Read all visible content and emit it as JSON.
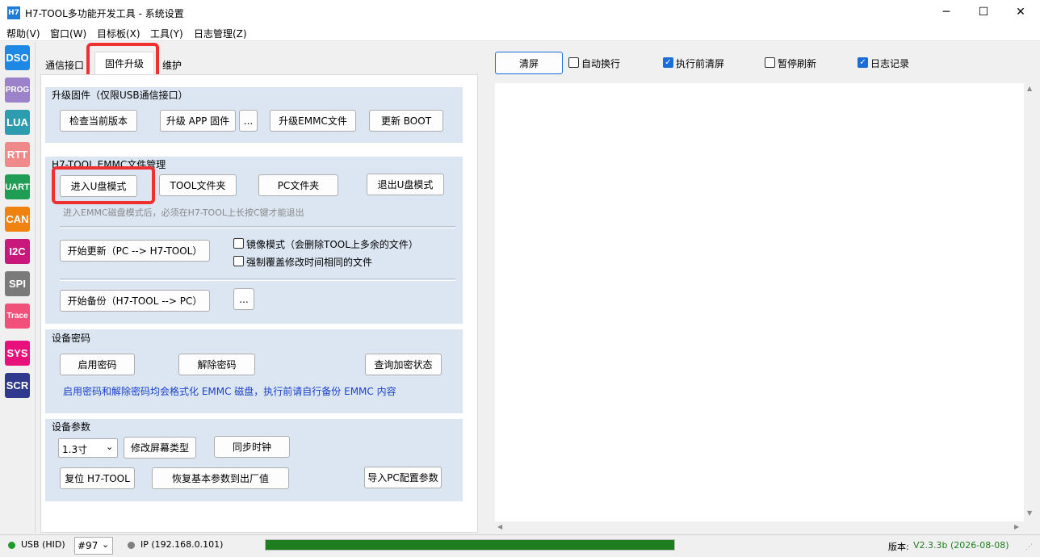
{
  "window": {
    "icon_label": "H7",
    "title": "H7-TOOL多功能开发工具 - 系统设置",
    "minimize_glyph": "─",
    "maximize_glyph": "☐",
    "close_glyph": "✕"
  },
  "menu": [
    "帮助(V)",
    "窗口(W)",
    "目标板(X)",
    "工具(Y)",
    "日志管理(Z)"
  ],
  "sidebar": [
    {
      "label": "DSO",
      "color": "#1e88e5"
    },
    {
      "label": "PROG",
      "color": "#9b82c9"
    },
    {
      "label": "LUA",
      "color": "#2c9cae"
    },
    {
      "label": "RTT",
      "color": "#f08a8a"
    },
    {
      "label": "UART",
      "color": "#1f9d55"
    },
    {
      "label": "CAN",
      "color": "#f0820f"
    },
    {
      "label": "I2C",
      "color": "#c8187c"
    },
    {
      "label": "SPI",
      "color": "#7a7a7a"
    },
    {
      "label": "Trace",
      "color": "#f0507a"
    },
    {
      "label": "SYS",
      "color": "#e8107a"
    },
    {
      "label": "SCR",
      "color": "#2f3a8f"
    }
  ],
  "tabs": [
    "通信接口",
    "固件升级",
    "维护"
  ],
  "upgrade": {
    "title": "升级固件（仅限USB通信接口）",
    "check_version": "检查当前版本",
    "upgrade_app": "升级 APP 固件",
    "browse": "...",
    "upgrade_emmc": "升级EMMC文件",
    "update_boot": "更新 BOOT"
  },
  "emmc": {
    "title": "H7-TOOL EMMC文件管理",
    "enter_udisk": "进入U盘模式",
    "tool_folder": "TOOL文件夹",
    "pc_folder": "PC文件夹",
    "exit_udisk": "退出U盘模式",
    "hint": "进入EMMC磁盘模式后，必须在H7-TOOL上长按C键才能退出",
    "start_update": "开始更新（PC --> H7-TOOL）",
    "mirror_mode": "镜像模式（会删除TOOL上多余的文件）",
    "force_overwrite": "强制覆盖修改时间相同的文件",
    "start_backup": "开始备份（H7-TOOL --> PC）",
    "browse": "..."
  },
  "password": {
    "title": "设备密码",
    "enable": "启用密码",
    "disable": "解除密码",
    "query": "查询加密状态",
    "note": "启用密码和解除密码均会格式化 EMMC 磁盘，执行前请自行备份 EMMC 内容",
    "note_color": "#1a3fc8"
  },
  "params": {
    "title": "设备参数",
    "screen_size": "1.3寸",
    "modify_screen": "修改屏幕类型",
    "sync_clock": "同步时钟",
    "reset": "复位 H7-TOOL",
    "restore_defaults": "恢复基本参数到出厂值",
    "import_pc": "导入PC配置参数"
  },
  "log_toolbar": {
    "clear": "清屏",
    "auto_wrap": "自动换行",
    "auto_wrap_checked": false,
    "clear_before_exec": "执行前清屏",
    "clear_before_exec_checked": true,
    "pause_refresh": "暂停刷新",
    "pause_refresh_checked": false,
    "log_record": "日志记录",
    "log_record_checked": true
  },
  "status": {
    "usb": "USB (HID)",
    "usb_color": "#1f9d2b",
    "port": "#97",
    "ip": "IP (192.168.0.101)",
    "ip_color": "#7f7f7f",
    "progress": 1.0,
    "progress_color": "#1e7d1e",
    "version_label": "版本:",
    "version": "V2.3.3b (2026-08-08)",
    "version_color": "#1f7d1f"
  }
}
